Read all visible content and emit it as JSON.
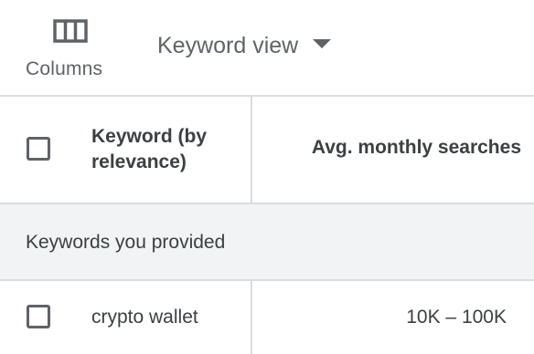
{
  "toolbar": {
    "columns_icon": "view-column-icon",
    "columns_label": "Columns",
    "view_label": "Keyword view",
    "view_caret_icon": "caret-down-icon"
  },
  "table": {
    "headers": {
      "keyword": "Keyword (by relevance)",
      "avg_monthly_searches": "Avg. monthly searches"
    },
    "groups": [
      {
        "label": "Keywords you provided",
        "rows": [
          {
            "keyword": "crypto wallet",
            "avg_monthly_searches": "10K – 100K"
          }
        ]
      }
    ]
  },
  "colors": {
    "text_primary": "#3c4043",
    "text_secondary": "#5f6368",
    "divider": "#dadce0",
    "group_background": "#f1f3f4"
  }
}
